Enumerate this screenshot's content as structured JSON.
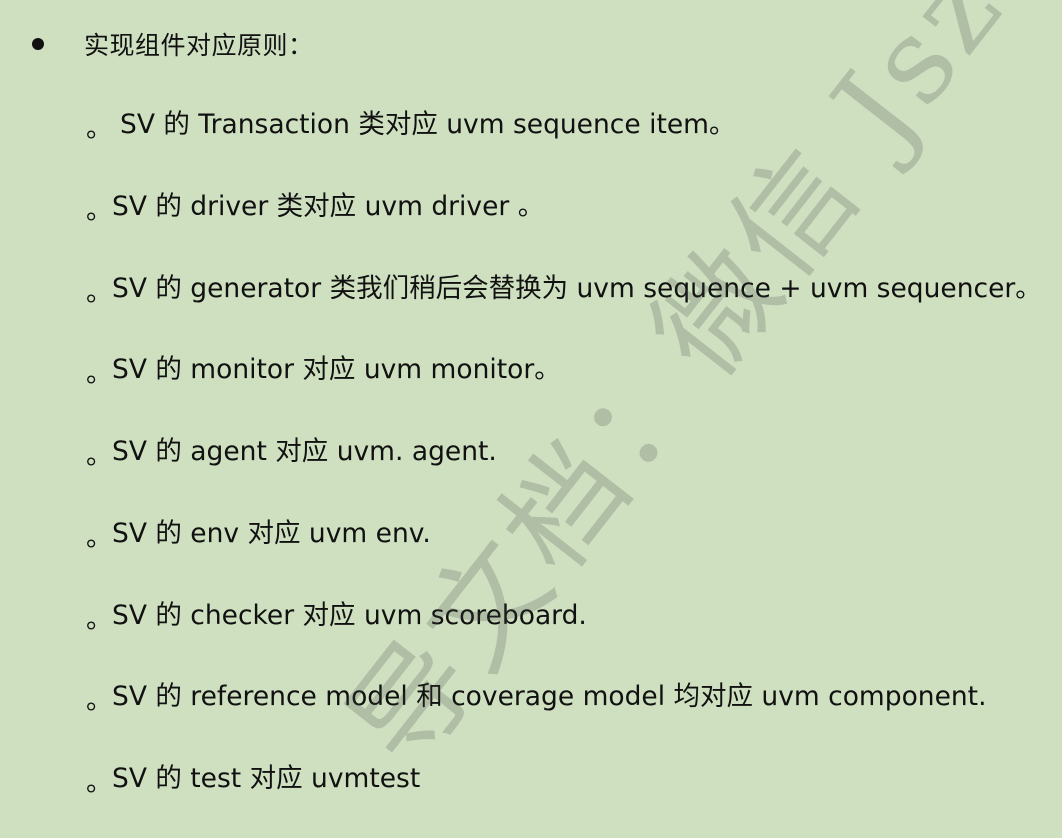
{
  "heading": "实现组件对应原则：",
  "items": [
    {
      "marker": "。",
      "text": "SV 的 Transaction 类对应 uvm sequence item。"
    },
    {
      "marker": "。",
      "text": "SV 的 driver 类对应 uvm driver 。"
    },
    {
      "marker": "。",
      "text": "SV 的 generator 类我们稍后会替换为 uvm sequence + uvm sequencer。"
    },
    {
      "marker": "。",
      "text": "SV 的 monitor 对应 uvm monitor。"
    },
    {
      "marker": "。",
      "text": "SV 的 agent 对应 uvm. agent."
    },
    {
      "marker": "。",
      "text": "SV 的 env 对应 uvm env."
    },
    {
      "marker": "。",
      "text": "SV 的 checker 对应 uvm scoreboard."
    },
    {
      "marker": "。",
      "text": "SV 的 reference model 和 coverage model 均对应 uvm component."
    },
    {
      "marker": "。",
      "text": "SV 的 test 对应 uvmtest"
    }
  ],
  "watermark": "导文档：微信 Jszdl"
}
